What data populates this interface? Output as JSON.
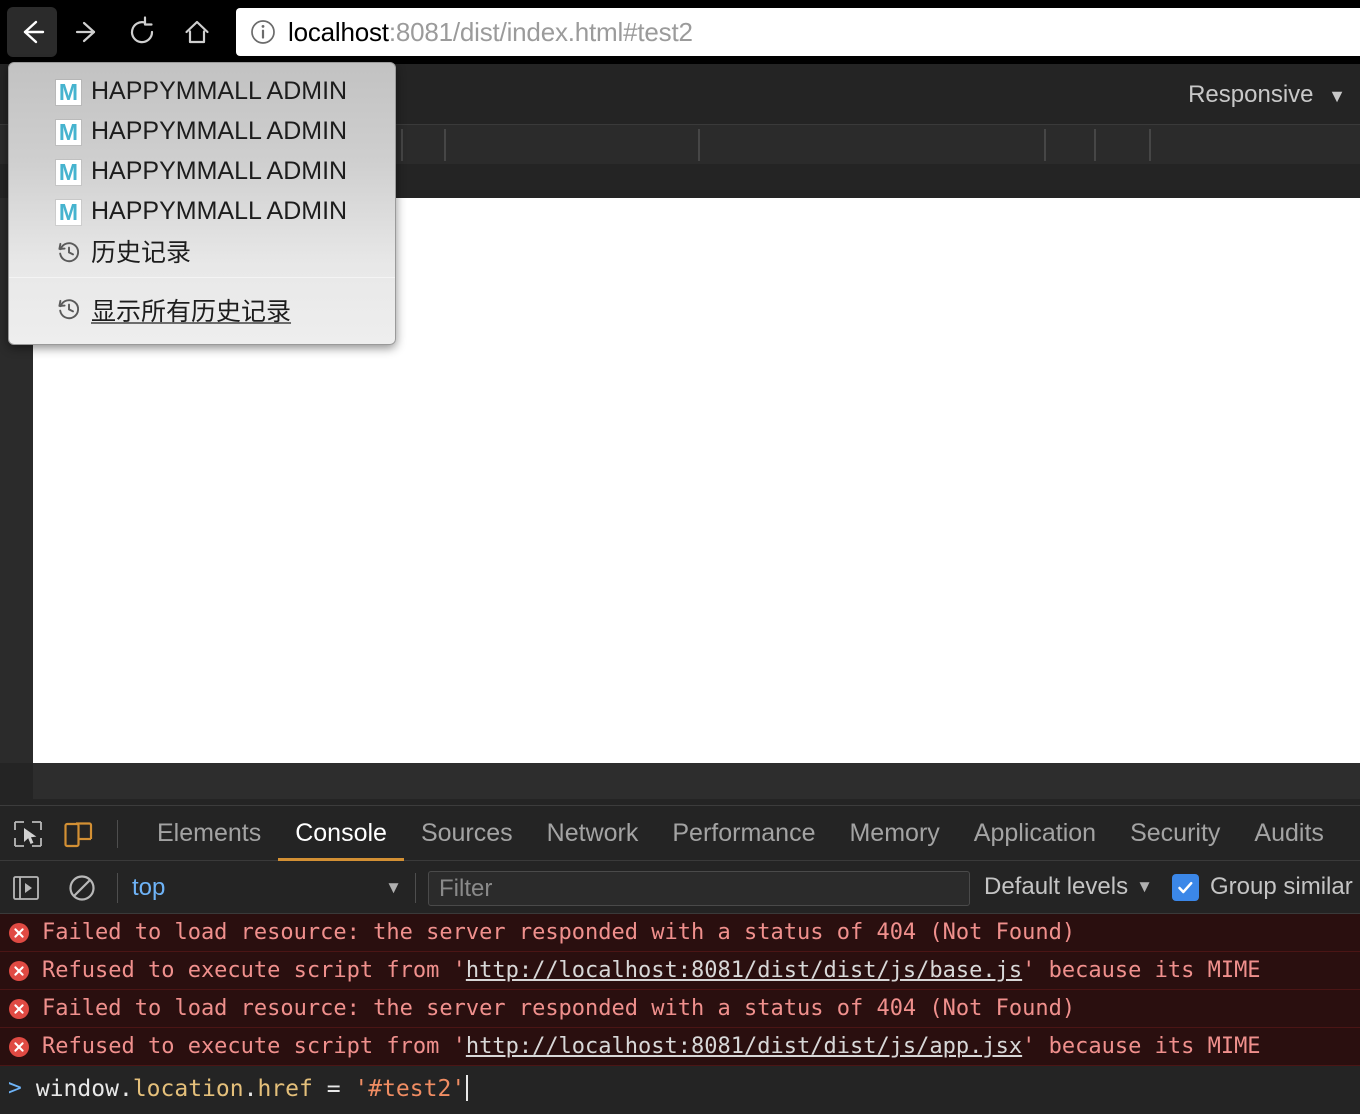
{
  "browser": {
    "nav": {
      "back_label": "Back",
      "forward_label": "Forward",
      "reload_label": "Reload",
      "home_label": "Home"
    },
    "omnibox": {
      "info_icon": "info-circle-icon",
      "url_host": "localhost",
      "url_rest": ":8081/dist/index.html#test2",
      "url_full": "localhost:8081/dist/index.html#test2"
    }
  },
  "history_menu": {
    "items": [
      {
        "icon": "happymmall-favicon",
        "favicon_letter": "M",
        "label": "HAPPYMMALL ADMIN"
      },
      {
        "icon": "happymmall-favicon",
        "favicon_letter": "M",
        "label": "HAPPYMMALL ADMIN"
      },
      {
        "icon": "happymmall-favicon",
        "favicon_letter": "M",
        "label": "HAPPYMMALL ADMIN"
      },
      {
        "icon": "happymmall-favicon",
        "favicon_letter": "M",
        "label": "HAPPYMMALL ADMIN"
      },
      {
        "icon": "history-clock-icon",
        "label": "历史记录"
      }
    ],
    "footer": {
      "icon": "history-clock-icon",
      "label": "显示所有历史记录"
    }
  },
  "device_mode": {
    "device_label": "Responsive",
    "caret": "▼"
  },
  "devtools": {
    "inspect_icon": "inspect-cursor-icon",
    "device_toolbar_icon": "device-toolbar-icon",
    "tabs": [
      {
        "label": "Elements",
        "active": false
      },
      {
        "label": "Console",
        "active": true
      },
      {
        "label": "Sources",
        "active": false
      },
      {
        "label": "Network",
        "active": false
      },
      {
        "label": "Performance",
        "active": false
      },
      {
        "label": "Memory",
        "active": false
      },
      {
        "label": "Application",
        "active": false
      },
      {
        "label": "Security",
        "active": false
      },
      {
        "label": "Audits",
        "active": false
      }
    ],
    "accent_color": "#d39034",
    "filterbar": {
      "execute_icon": "execute-snippet-icon",
      "clear_icon": "clear-console-icon",
      "context_value": "top",
      "context_caret": "▼",
      "filter_placeholder": "Filter",
      "levels_value": "Default levels",
      "levels_caret": "▼",
      "group_similar_label": "Group similar",
      "group_similar_checked": true,
      "checkbox_color": "#3b87e8"
    },
    "console_messages": [
      {
        "level": "error",
        "icon": "error-circle-icon",
        "pre": "Failed to load resource: the server responded with a status of 404 (Not Found)",
        "link": "",
        "post": ""
      },
      {
        "level": "error",
        "icon": "error-circle-icon",
        "pre": "Refused to execute script from '",
        "link": "http://localhost:8081/dist/dist/js/base.js",
        "post": "' because its MIME"
      },
      {
        "level": "error",
        "icon": "error-circle-icon",
        "pre": "Failed to load resource: the server responded with a status of 404 (Not Found)",
        "link": "",
        "post": ""
      },
      {
        "level": "error",
        "icon": "error-circle-icon",
        "pre": "Refused to execute script from '",
        "link": "http://localhost:8081/dist/dist/js/app.jsx",
        "post": "' because its MIME"
      }
    ],
    "prompt": {
      "chevron": ">",
      "tokens": [
        {
          "text": "window",
          "type": "plain"
        },
        {
          "text": ".",
          "type": "plain"
        },
        {
          "text": "location",
          "type": "prop"
        },
        {
          "text": ".",
          "type": "plain"
        },
        {
          "text": "href",
          "type": "prop"
        },
        {
          "text": " = ",
          "type": "plain"
        },
        {
          "text": "'#test2'",
          "type": "str"
        }
      ],
      "raw": "window.location.href = '#test2'"
    }
  }
}
